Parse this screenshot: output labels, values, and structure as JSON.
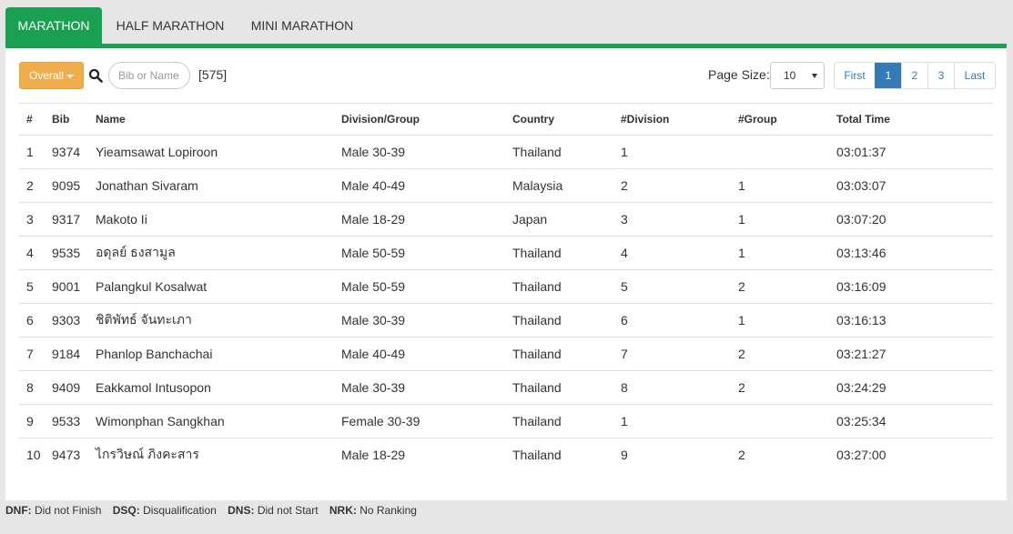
{
  "tabs": [
    {
      "label": "MARATHON",
      "active": true
    },
    {
      "label": "HALF MARATHON",
      "active": false
    },
    {
      "label": "MINI MARATHON",
      "active": false
    }
  ],
  "toolbar": {
    "overall_label": "Overall",
    "search_placeholder": "Bib or Name",
    "count": "[575]",
    "page_size_label": "Page Size:",
    "page_size_value": "10"
  },
  "pagination": {
    "first": "First",
    "pages": [
      "1",
      "2",
      "3"
    ],
    "current": "1",
    "last": "Last"
  },
  "table": {
    "headers": [
      "#",
      "Bib",
      "Name",
      "Division/Group",
      "Country",
      "#Division",
      "#Group",
      "Total Time"
    ],
    "rows": [
      [
        "1",
        "9374",
        "Yieamsawat Lopiroon",
        "Male 30-39",
        "Thailand",
        "1",
        "",
        "03:01:37"
      ],
      [
        "2",
        "9095",
        "Jonathan Sivaram",
        "Male 40-49",
        "Malaysia",
        "2",
        "1",
        "03:03:07"
      ],
      [
        "3",
        "9317",
        "Makoto Ii",
        "Male 18-29",
        "Japan",
        "3",
        "1",
        "03:07:20"
      ],
      [
        "4",
        "9535",
        "อดุลย์ ธงสามูล",
        "Male 50-59",
        "Thailand",
        "4",
        "1",
        "03:13:46"
      ],
      [
        "5",
        "9001",
        "Palangkul Kosalwat",
        "Male 50-59",
        "Thailand",
        "5",
        "2",
        "03:16:09"
      ],
      [
        "6",
        "9303",
        "ชิติพัทธ์ จันทะเภา",
        "Male 30-39",
        "Thailand",
        "6",
        "1",
        "03:16:13"
      ],
      [
        "7",
        "9184",
        "Phanlop Banchachai",
        "Male 40-49",
        "Thailand",
        "7",
        "2",
        "03:21:27"
      ],
      [
        "8",
        "9409",
        "Eakkamol Intusopon",
        "Male 30-39",
        "Thailand",
        "8",
        "2",
        "03:24:29"
      ],
      [
        "9",
        "9533",
        "Wimonphan Sangkhan",
        "Female 30-39",
        "Thailand",
        "1",
        "",
        "03:25:34"
      ],
      [
        "10",
        "9473",
        "ไกรวิษณ์ ภิงคะสาร",
        "Male 18-29",
        "Thailand",
        "9",
        "2",
        "03:27:00"
      ]
    ]
  },
  "legend": [
    {
      "abbr": "DNF:",
      "text": "Did not Finish"
    },
    {
      "abbr": "DSQ:",
      "text": "Disqualification"
    },
    {
      "abbr": "DNS:",
      "text": "Did not Start"
    },
    {
      "abbr": "NRK:",
      "text": "No Ranking"
    }
  ],
  "colors": {
    "accent": "#1aa053",
    "overall_button": "#f0ad4e",
    "pagination_active": "#337ab7"
  }
}
